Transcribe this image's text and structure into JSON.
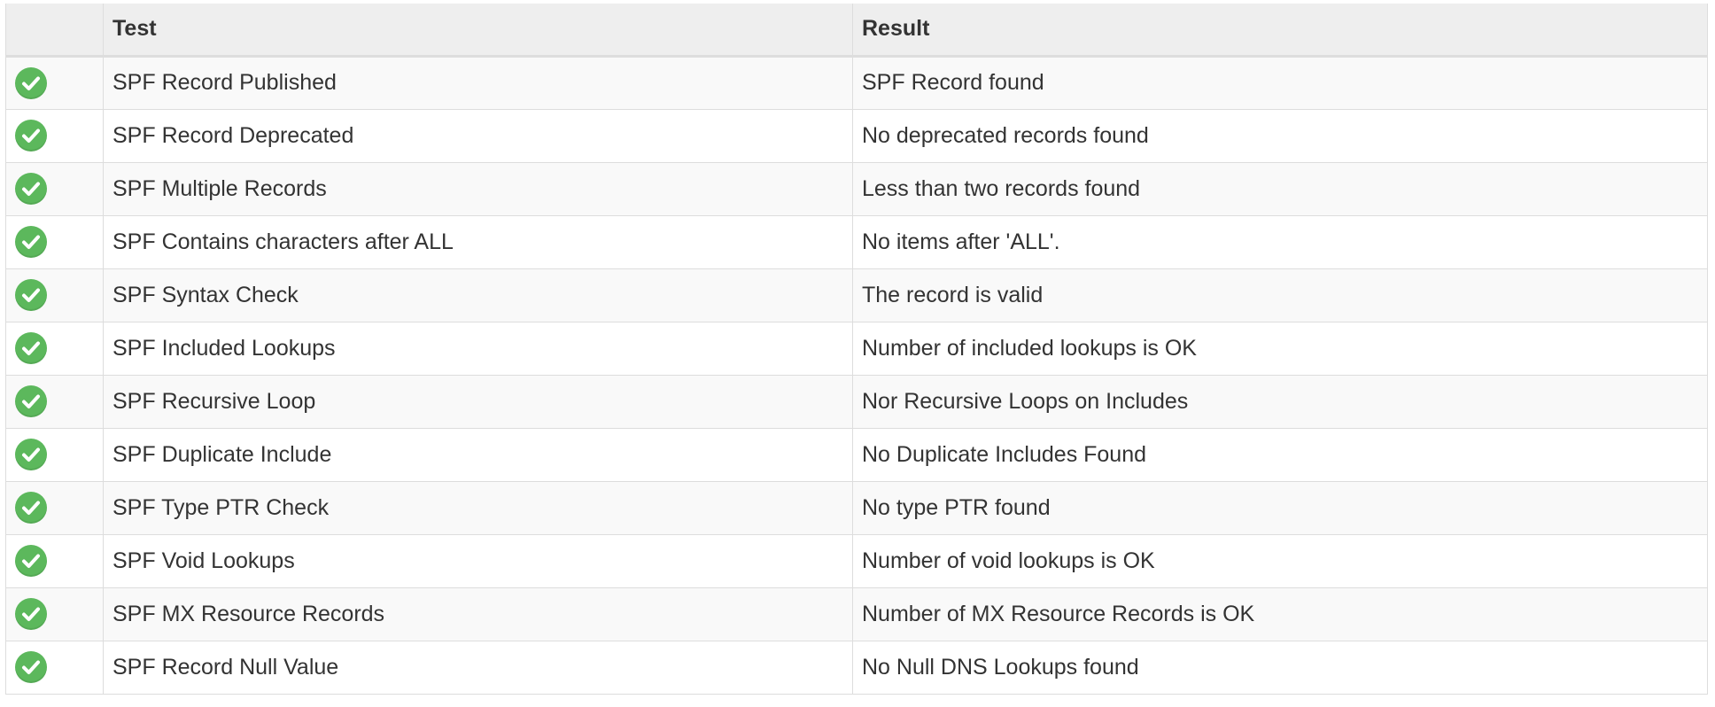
{
  "table": {
    "columns": [
      "",
      "Test",
      "Result"
    ],
    "rows": [
      {
        "status": "check-icon",
        "test": "SPF Record Published",
        "result": "SPF Record found"
      },
      {
        "status": "check-icon",
        "test": "SPF Record Deprecated",
        "result": "No deprecated records found"
      },
      {
        "status": "check-icon",
        "test": "SPF Multiple Records",
        "result": "Less than two records found"
      },
      {
        "status": "check-icon",
        "test": "SPF Contains characters after ALL",
        "result": "No items after 'ALL'."
      },
      {
        "status": "check-icon",
        "test": "SPF Syntax Check",
        "result": "The record is valid"
      },
      {
        "status": "check-icon",
        "test": "SPF Included Lookups",
        "result": "Number of included lookups is OK"
      },
      {
        "status": "check-icon",
        "test": "SPF Recursive Loop",
        "result": "Nor Recursive Loops on Includes"
      },
      {
        "status": "check-icon",
        "test": "SPF Duplicate Include",
        "result": "No Duplicate Includes Found"
      },
      {
        "status": "check-icon",
        "test": "SPF Type PTR Check",
        "result": "No type PTR found"
      },
      {
        "status": "check-icon",
        "test": "SPF Void Lookups",
        "result": "Number of void lookups is OK"
      },
      {
        "status": "check-icon",
        "test": "SPF MX Resource Records",
        "result": "Number of MX Resource Records is OK"
      },
      {
        "status": "check-icon",
        "test": "SPF Record Null Value",
        "result": "No Null DNS Lookups found"
      }
    ]
  },
  "colors": {
    "check": "#5cb85c",
    "header_bg": "#eeeeee",
    "row_stripe": "#f9f9f9",
    "border": "#dddddd"
  }
}
